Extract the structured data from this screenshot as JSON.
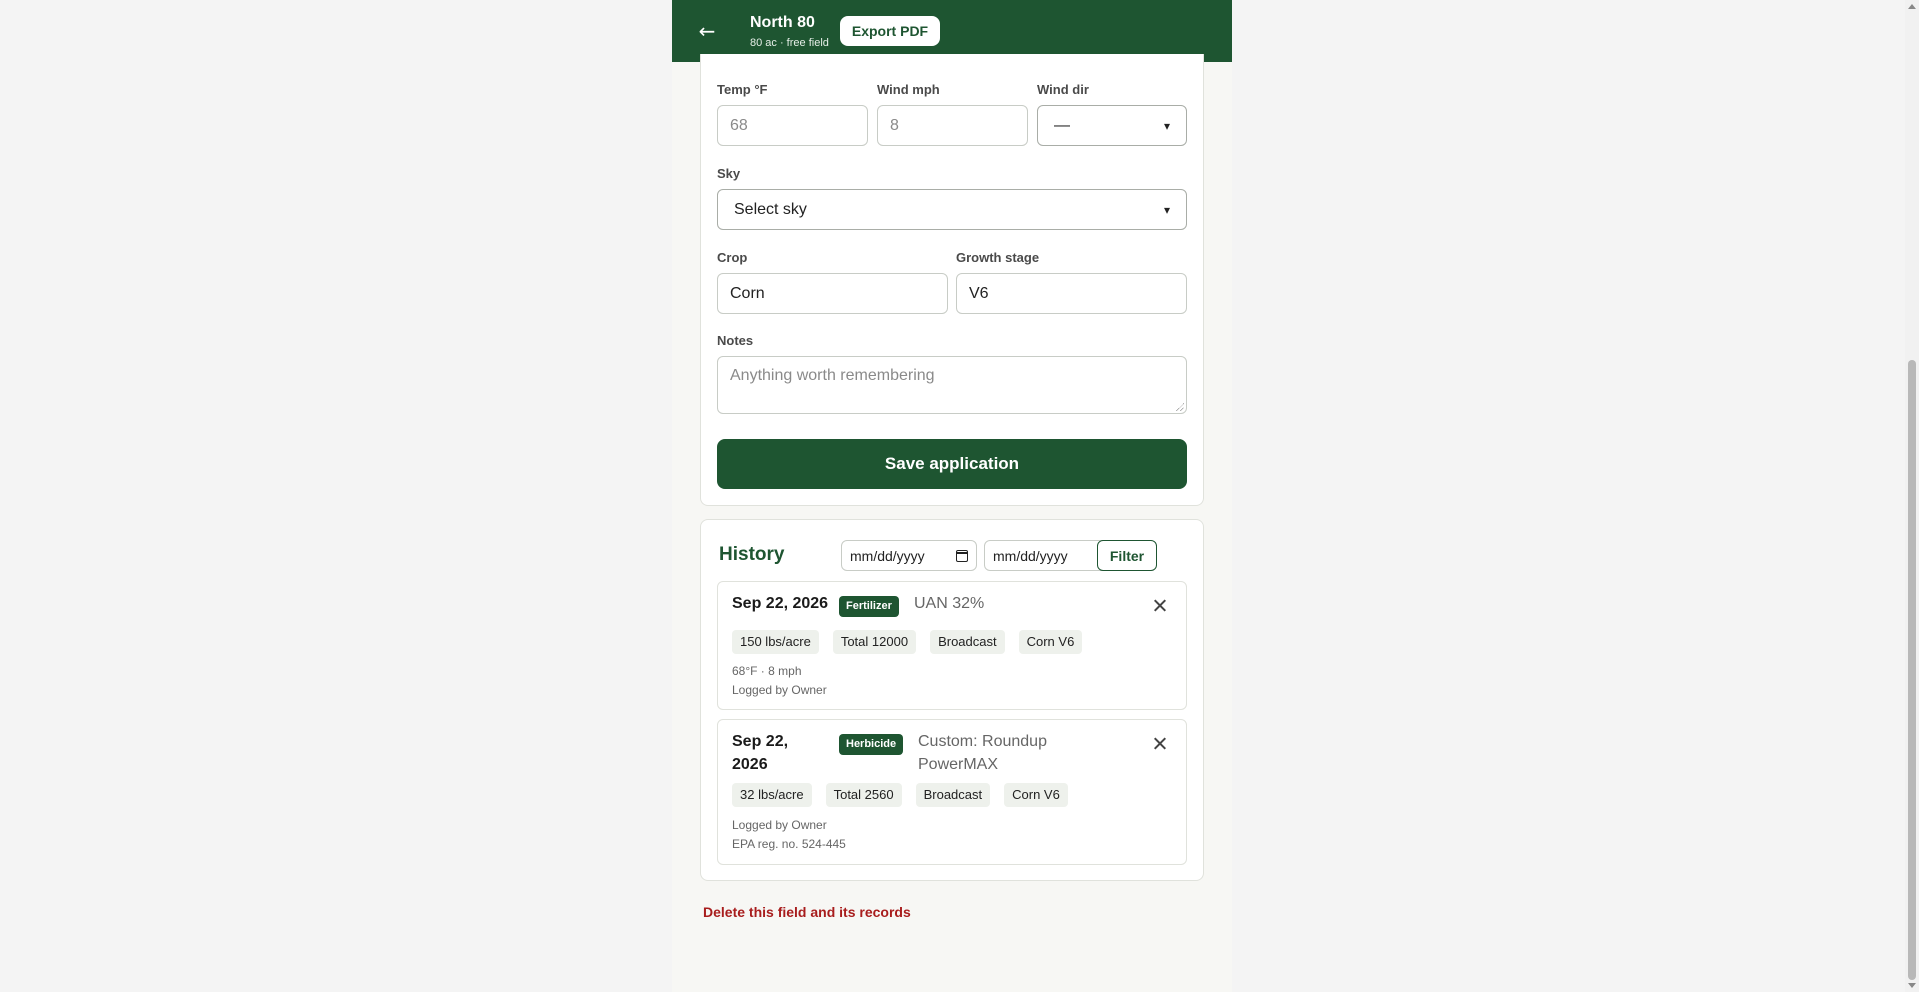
{
  "header": {
    "back_icon": "←",
    "title": "North 80",
    "subtitle": "80 ac · free field",
    "export_label": "Export PDF"
  },
  "form": {
    "temp": {
      "label": "Temp °F",
      "placeholder": "68"
    },
    "wind_mph": {
      "label": "Wind mph",
      "placeholder": "8"
    },
    "wind_dir": {
      "label": "Wind dir",
      "value": "—"
    },
    "sky": {
      "label": "Sky",
      "value": "Select sky"
    },
    "crop": {
      "label": "Crop",
      "value": "Corn"
    },
    "growth_stage": {
      "label": "Growth stage",
      "value": "V6"
    },
    "notes": {
      "label": "Notes",
      "placeholder": "Anything worth remembering"
    },
    "save_label": "Save application"
  },
  "history": {
    "title": "History",
    "date_from_placeholder": "mm/dd/yyyy",
    "date_to_placeholder": "mm/dd/yyyy",
    "filter_label": "Filter",
    "records": [
      {
        "date": "Sep 22, 2026",
        "type": "Fertilizer",
        "product": "UAN 32%",
        "chips": [
          "150 lbs/acre",
          "Total 12000",
          "Broadcast",
          "Corn V6"
        ],
        "meta": [
          "68°F · 8 mph",
          "Logged by Owner"
        ]
      },
      {
        "date_line1": "Sep 22,",
        "date_line2": "2026",
        "type": "Herbicide",
        "product_line1": "Custom: Roundup",
        "product_line2": "PowerMAX",
        "chips": [
          "32 lbs/acre",
          "Total 2560",
          "Broadcast",
          "Corn V6"
        ],
        "meta": [
          "Logged by Owner",
          "EPA reg. no. 524-445"
        ]
      }
    ]
  },
  "delete_label": "Delete this field and its records",
  "colors": {
    "brand": "#1e5531",
    "danger": "#a81d1d"
  },
  "icons": {
    "back": "arrow-left-icon",
    "close": "close-icon",
    "calendar": "calendar-icon",
    "select": "chevron-down-icon"
  }
}
